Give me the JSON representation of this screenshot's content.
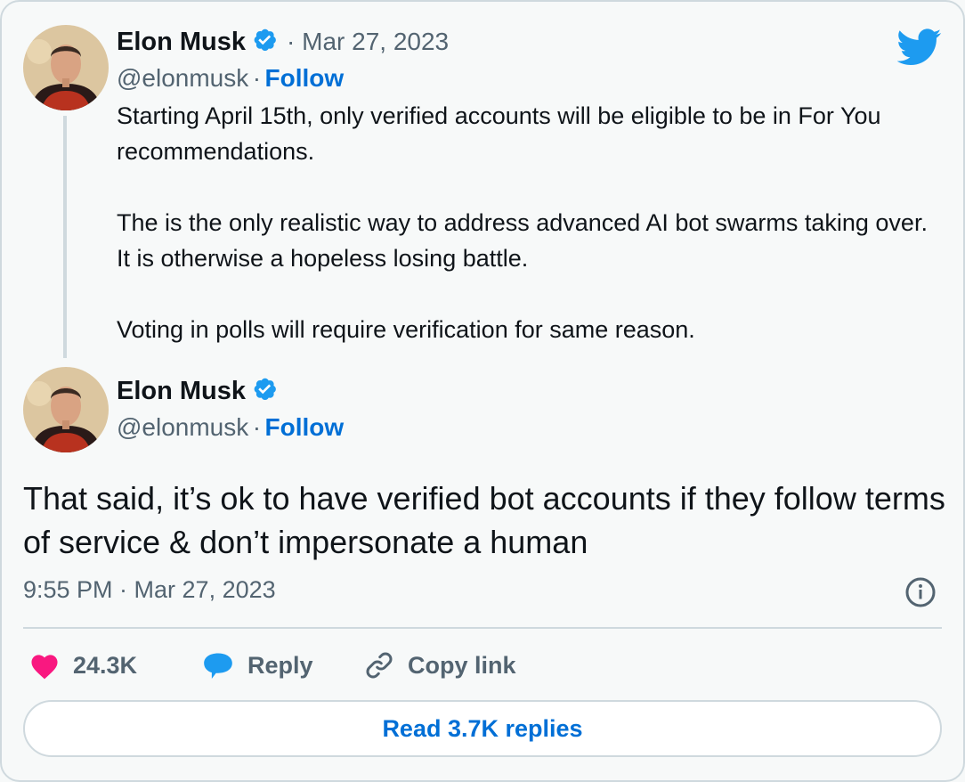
{
  "colors": {
    "accent": "#1d9bf0",
    "link": "#006fd6",
    "text": "#0f1419",
    "muted": "#536471",
    "heart": "#f91880",
    "border": "#cfd9de"
  },
  "quoted_tweet": {
    "author_name": "Elon Musk",
    "separator_date": "· Mar 27, 2023",
    "handle": "@elonmusk",
    "dot": "·",
    "follow_label": "Follow",
    "paragraphs": [
      "Starting April 15th, only verified accounts will be eligible to be in For You recommendations.",
      "The is the only realistic way to address advanced AI bot swarms taking over. It is otherwise a hopeless losing battle.",
      "Voting in polls will require verification for same reason."
    ]
  },
  "main_tweet": {
    "author_name": "Elon Musk",
    "handle": "@elonmusk",
    "dot": "·",
    "follow_label": "Follow",
    "text": "That said, it’s ok to have verified bot accounts if they follow terms of service & don’t impersonate a human",
    "timestamp": "9:55 PM · Mar 27, 2023"
  },
  "actions": {
    "likes": "24.3K",
    "reply_label": "Reply",
    "copy_link_label": "Copy link"
  },
  "read_replies_label": "Read 3.7K replies",
  "icons": [
    "twitter-bird-icon",
    "verified-badge-icon",
    "info-icon",
    "heart-icon",
    "reply-bubble-icon",
    "link-icon"
  ]
}
